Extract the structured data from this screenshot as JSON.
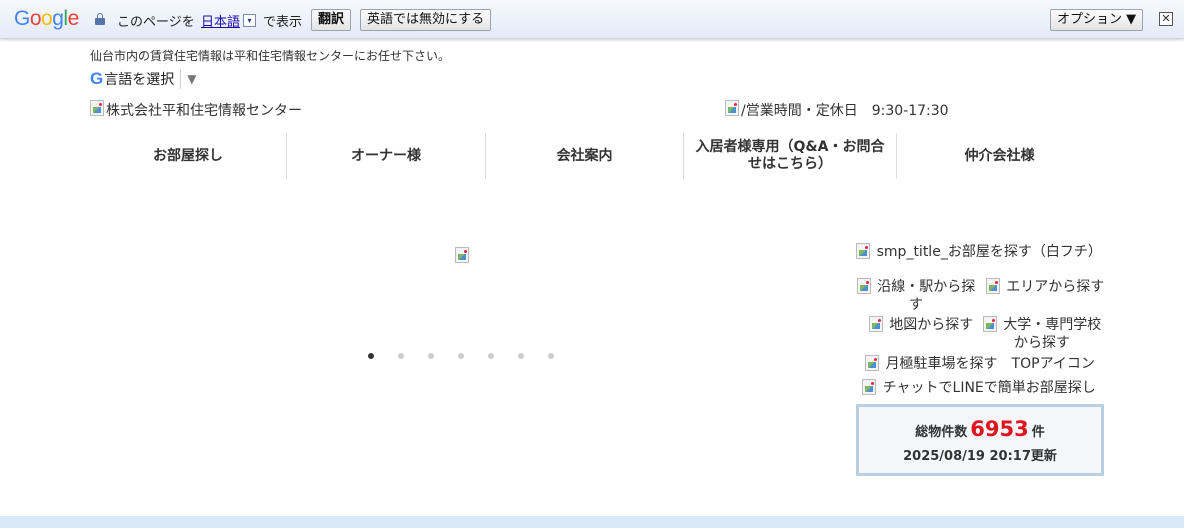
{
  "translate_bar": {
    "logo": [
      "G",
      "o",
      "o",
      "g",
      "l",
      "e"
    ],
    "logo_colors": [
      "#4285f4",
      "#ea4335",
      "#fbbc05",
      "#4285f4",
      "#34a853",
      "#ea4335"
    ],
    "prefix": "このページを",
    "language": "日本語",
    "dropdown": "▾",
    "suffix": "で表示",
    "translate_button": "翻訳",
    "disable_button": "英語では無効にする",
    "options_button": "オプション ▼",
    "close": "✕"
  },
  "header": {
    "tagline": "仙台市内の賃貸住宅情報は平和住宅情報センターにお任せ下さい。",
    "lang_select": {
      "g": "G",
      "label": "言語を選択",
      "arrow": "▼"
    },
    "company_alt": "株式会社平和住宅情報センター",
    "hours_alt": "/営業時間・定休日　9:30-17:30"
  },
  "nav": [
    "お部屋探し",
    "オーナー様",
    "会社案内",
    "入居者様専用（Q&A・お問合せはこちら）",
    "仲介会社様"
  ],
  "slider": {
    "total": 7,
    "active": 0
  },
  "side": {
    "title_alt": "smp_title_お部屋を探す（白フチ）",
    "line_station": "沿線・駅から探す",
    "area": "エリアから探す",
    "map": "地図から探す",
    "school": "大学・専門学校から探す",
    "parking": "月極駐車場を探す　TOPアイコン",
    "line_chat": "チャットでLINEで簡単お部屋探し"
  },
  "count": {
    "label": "総物件数",
    "value": "6953",
    "unit": "件",
    "updated": "2025/08/19 20:17更新"
  },
  "colors": {
    "accent_red": "#e0141e",
    "box_border": "#b9cde3",
    "footer_band": "#d9e9f9"
  }
}
